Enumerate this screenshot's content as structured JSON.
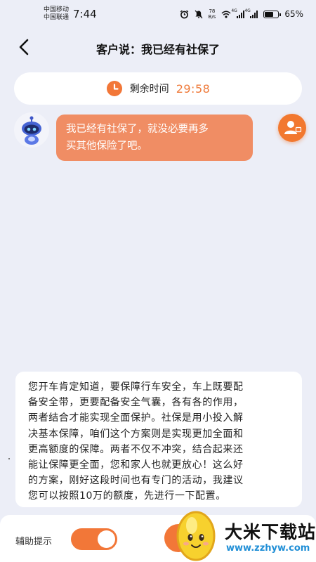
{
  "status_bar": {
    "carrier_1": "中国移动",
    "carrier_2": "中国联通",
    "time": "7:44",
    "net_speed_value": "78",
    "net_speed_unit": "B/s",
    "signal_1_tag": "4G",
    "signal_2_tag": "4G",
    "battery": "65%"
  },
  "header": {
    "title": "客户说：我已经有社保了"
  },
  "timer": {
    "label": "剩余时间",
    "value": "29:58"
  },
  "chat": {
    "customer_message_lines": [
      "我已经有社保了，就没必要再多",
      "买其他保险了吧。"
    ]
  },
  "hint": {
    "lines": [
      "您开车肯定知道，要保障行车安全，车上既要配",
      "备安全带，更要配备安全气囊，各有各的作用，",
      "两者结合才能实现全面保护。社保是用小投入解",
      "决基本保障，咱们这个方案则是实现更加全面和",
      "更高额度的保障。两者不仅不冲突，结合起来还",
      "能让保障更全面，您和家人也就更放心！这么好",
      "的方案，刚好这段时间也有专门的活动，我建议",
      "您可以按照10万的额度，先进行一下配置。"
    ]
  },
  "bottom_bar": {
    "assist_label": "辅助提示",
    "assist_enabled": true
  },
  "watermark": {
    "title": "大米下载站",
    "url": "www.zzhyw.com"
  },
  "colors": {
    "accent": "#f27738",
    "bubble": "#f08d64",
    "timer_value": "#ef7a3a",
    "background": "#eceef7",
    "watermark_url": "#1f8ed6"
  }
}
